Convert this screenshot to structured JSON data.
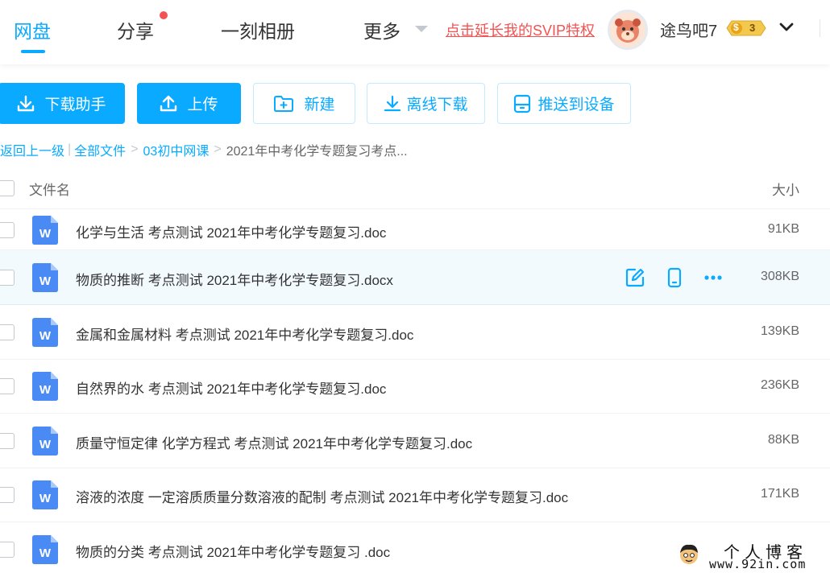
{
  "nav": {
    "items": [
      {
        "label": "网盘",
        "active": true
      },
      {
        "label": "分享",
        "active": false,
        "has_dot": true
      },
      {
        "label": "一刻相册",
        "active": false
      },
      {
        "label": "更多",
        "active": false
      }
    ],
    "svip_promo": "点击延长我的SVIP特权",
    "username": "途鸟吧7",
    "coin_symbol": "$",
    "coin_count": "3"
  },
  "toolbar": {
    "download_helper": "下载助手",
    "upload": "上传",
    "new_folder": "新建",
    "offline_download": "离线下载",
    "push_to_device": "推送到设备"
  },
  "breadcrumb": {
    "back": "返回上一级",
    "separator_bar": "|",
    "all_files": "全部文件",
    "arrow": ">",
    "folder": "03初中网课",
    "current": "2021年中考化学专题复习考点..."
  },
  "table": {
    "headers": {
      "name": "文件名",
      "size": "大小"
    },
    "rows": [
      {
        "icon": "word-doc-icon",
        "name": "化学与生活 考点测试 2021年中考化学专题复习.doc",
        "size": "91KB"
      },
      {
        "icon": "word-doc-icon",
        "name": "物质的推断 考点测试 2021年中考化学专题复习.docx",
        "size": "308KB",
        "hovered": true
      },
      {
        "icon": "word-doc-icon",
        "name": "金属和金属材料 考点测试 2021年中考化学专题复习.doc",
        "size": "139KB"
      },
      {
        "icon": "word-doc-icon",
        "name": "自然界的水 考点测试 2021年中考化学专题复习.doc",
        "size": "236KB"
      },
      {
        "icon": "word-doc-icon",
        "name": "质量守恒定律 化学方程式 考点测试 2021年中考化学专题复习.doc",
        "size": "88KB"
      },
      {
        "icon": "word-doc-icon",
        "name": "溶液的浓度 一定溶质质量分数溶液的配制 考点测试 2021年中考化学专题复习.doc",
        "size": "171KB"
      },
      {
        "icon": "word-doc-icon",
        "name": "物质的分类 考点测试 2021年中考化学专题复习 .doc",
        "size": ""
      }
    ]
  },
  "icon_letter": "W",
  "watermark": {
    "title": "个人博客",
    "url": "www.92in.com"
  },
  "colors": {
    "accent": "#09aaff",
    "promo_red": "#f25353",
    "word_blue": "#4a8af4",
    "row_hover": "#f2fafe"
  }
}
